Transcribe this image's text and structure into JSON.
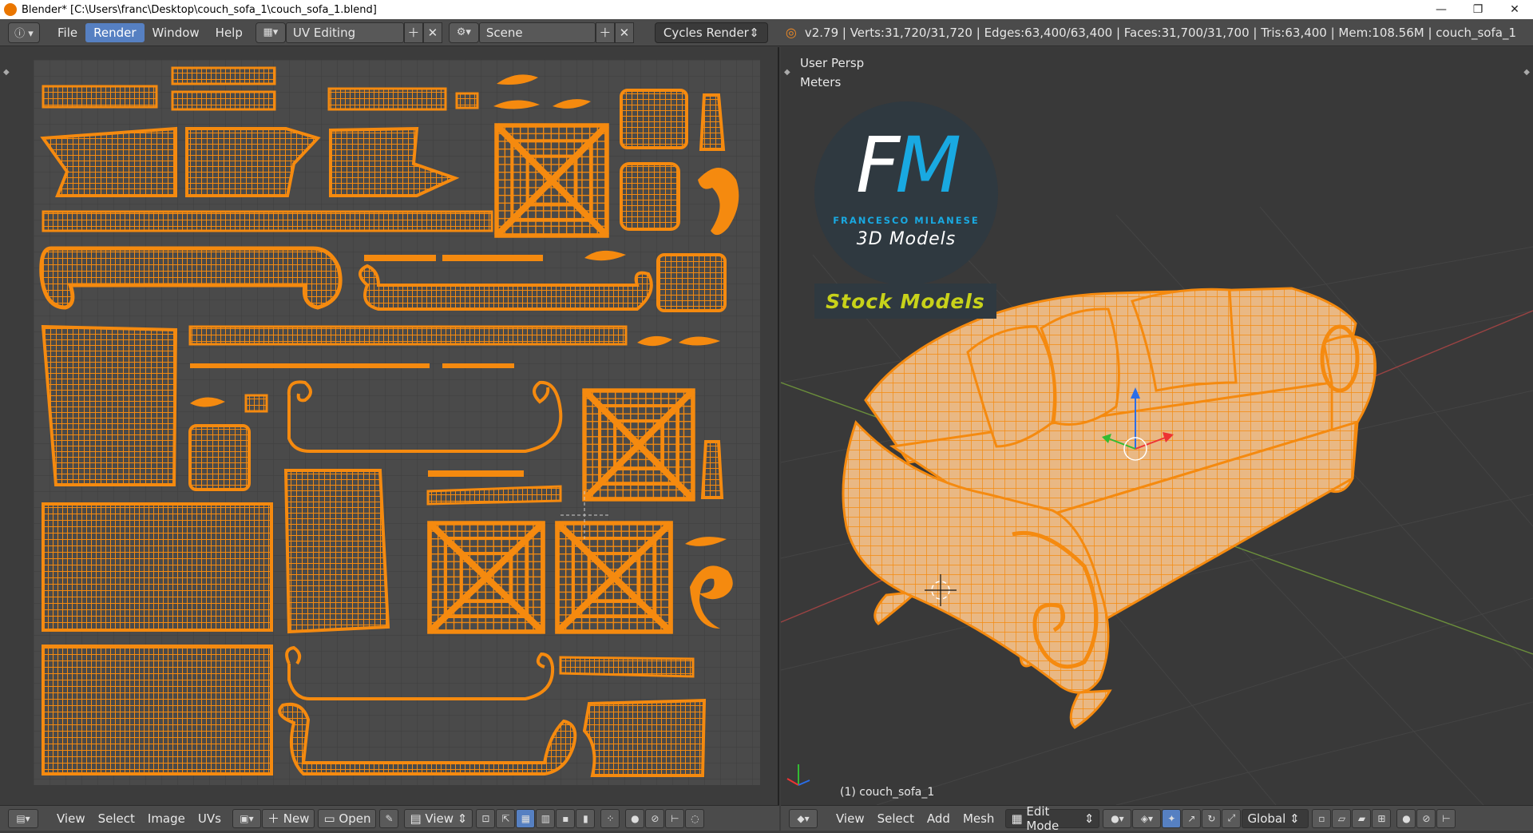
{
  "window": {
    "title": "Blender* [C:\\Users\\franc\\Desktop\\couch_sofa_1\\couch_sofa_1.blend]",
    "controls": [
      "—",
      "❐",
      "✕"
    ]
  },
  "info_header": {
    "menus": [
      "File",
      "Render",
      "Window",
      "Help"
    ],
    "active_menu": "Render",
    "screen_layout": "UV Editing",
    "scene": "Scene",
    "render_engine": "Cycles Render",
    "stats": "v2.79 | Verts:31,720/31,720 | Edges:63,400/63,400 | Faces:31,700/31,700 | Tris:63,400 | Mem:108.56M | couch_sofa_1"
  },
  "viewport": {
    "view_label": "User Persp",
    "units_label": "Meters",
    "object_label": "(1) couch_sofa_1"
  },
  "logo": {
    "letter_f": "F",
    "letter_m": "M",
    "name": "FRANCESCO MILANESE",
    "subtitle": "3D Models",
    "stock": "Stock Models",
    "colors": {
      "dark": "#2f3940",
      "blue": "#19a9e1",
      "stock_text": "#c8d21a"
    }
  },
  "uv_footer": {
    "menus": [
      "View",
      "Select",
      "Image",
      "UVs"
    ],
    "new_label": "New",
    "open_label": "Open",
    "view_dropdown": "View"
  },
  "vp_footer": {
    "menus": [
      "View",
      "Select",
      "Add",
      "Mesh"
    ],
    "mode": "Edit Mode",
    "orientation": "Global"
  },
  "colors": {
    "mesh_orange": "#f58a0f",
    "background": "#3d3d3d",
    "header": "#4b4b4b",
    "active_blue": "#5680c2"
  }
}
